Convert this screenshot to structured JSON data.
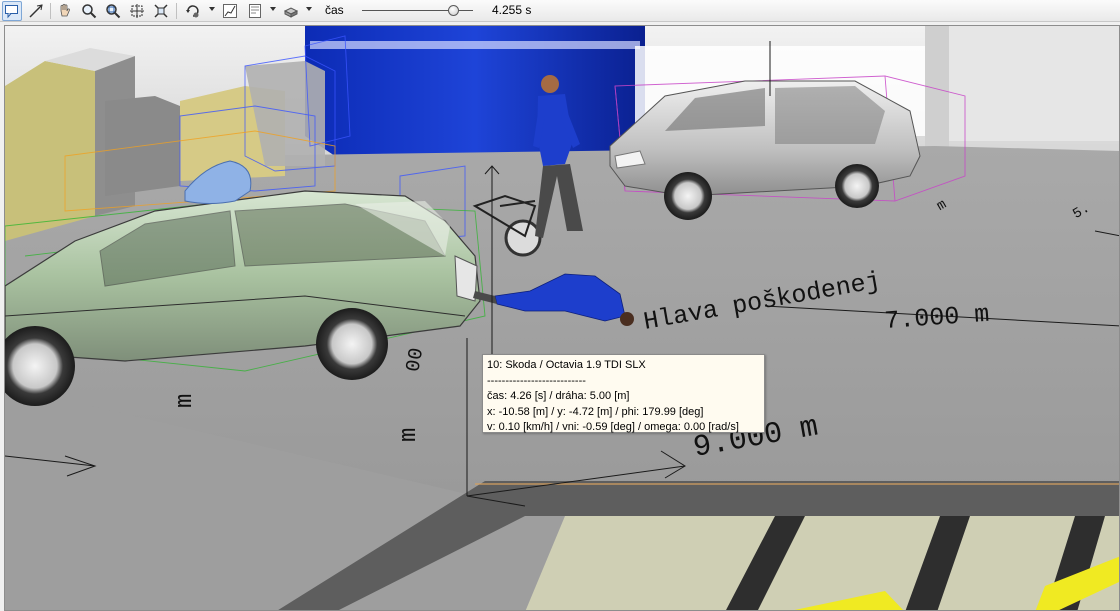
{
  "toolbar": {
    "tools": [
      {
        "name": "select-tool",
        "icon": "tooltip-select-icon",
        "active": true
      },
      {
        "name": "measure-tool",
        "icon": "measure-line-icon"
      },
      {
        "name": "pan-tool",
        "icon": "hand-icon"
      },
      {
        "name": "zoom-tool",
        "icon": "magnifier-icon"
      },
      {
        "name": "zoom-window-tool",
        "icon": "zoom-window-icon"
      },
      {
        "name": "zoom-extents-tool",
        "icon": "zoom-extents-icon"
      },
      {
        "name": "zoom-fit-tool",
        "icon": "zoom-fit-icon"
      },
      {
        "name": "rotate-tool",
        "icon": "rotate-view-icon"
      },
      {
        "name": "graph-tool",
        "icon": "graph-icon"
      },
      {
        "name": "layout-tool",
        "icon": "panel-icon"
      },
      {
        "name": "render-tool",
        "icon": "shading-icon"
      }
    ],
    "time_label": "čas",
    "time_value": "4.255 s",
    "time_slider_fraction": 0.82
  },
  "scene": {
    "label_head": "Hlava poškodenej",
    "label_head_distance": "7.000 m",
    "label_mid_distance": "9.000 m",
    "label_m1": "m",
    "label_m2": "m",
    "label_zeros": "00",
    "label_m_edge": "m",
    "label_5": "5."
  },
  "tooltip": {
    "line1": "10: Skoda / Octavia 1.9 TDI SLX",
    "line2": "---------------------------",
    "line3": "čas: 4.26 [s] / dráha: 5.00 [m]",
    "line4": "x: -10.58 [m] / y: -4.72 [m] / phi: 179.99 [deg]",
    "line5": "v: 0.10 [km/h] / vni: -0.59 [deg] / omega: 0.00 [rad/s]"
  },
  "colors": {
    "accent": "#0a2fc0",
    "ground": "#8e8e8e",
    "road_stripe": "#e8e020",
    "green_car": "#b8d4b0",
    "white_car": "#d6d6d6"
  }
}
